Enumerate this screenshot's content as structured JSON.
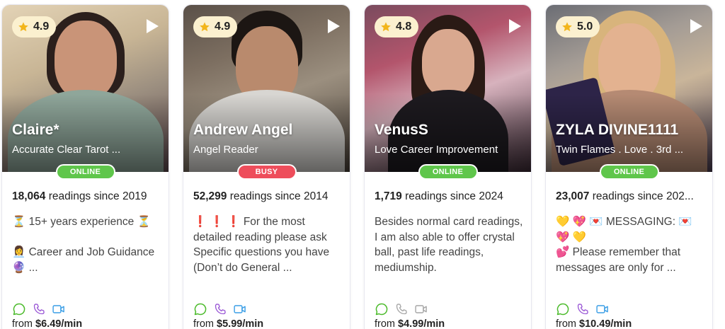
{
  "cards": [
    {
      "rating": "4.9",
      "name": "Claire*",
      "tagline": "Accurate Clear Tarot ...",
      "status": "ONLINE",
      "readings_count": "18,064",
      "readings_suffix": " readings since 2019",
      "description": "⏳ 15+ years experience ⏳\n\n👩‍💼 Career and Job Guidance 🔮 ...",
      "price_prefix": "from ",
      "price": "$6.49/min",
      "contact_icons": [
        "chat-icon",
        "phone-icon",
        "video-icon"
      ],
      "icon_colors": [
        "#4cbb2c",
        "#9b59d6",
        "#3a9ee6"
      ]
    },
    {
      "rating": "4.9",
      "name": "Andrew Angel",
      "tagline": "Angel Reader",
      "status": "BUSY",
      "readings_count": "52,299",
      "readings_suffix": " readings since 2014",
      "description": "❗ ❗ ❗ For the most detailed reading please ask Specific questions you have (Don’t do General ...",
      "price_prefix": "from ",
      "price": "$5.99/min",
      "contact_icons": [
        "chat-icon",
        "phone-icon",
        "video-icon"
      ],
      "icon_colors": [
        "#4cbb2c",
        "#9b59d6",
        "#3a9ee6"
      ]
    },
    {
      "rating": "4.8",
      "name": "VenusS",
      "tagline": "Love Career Improvement",
      "status": "ONLINE",
      "readings_count": "1,719",
      "readings_suffix": " readings since 2024",
      "description": "Besides normal card readings, I am also able to offer crystal ball, past life readings, mediumship.",
      "price_prefix": "from ",
      "price": "$4.99/min",
      "contact_icons": [
        "chat-icon",
        "phone-icon",
        "video-icon"
      ],
      "icon_colors": [
        "#4cbb2c",
        "#a6a6a6",
        "#a6a6a6"
      ]
    },
    {
      "rating": "5.0",
      "name": "ZYLA DIVINE1111",
      "tagline": "Twin Flames . Love . 3rd ...",
      "status": "ONLINE",
      "readings_count": "23,007",
      "readings_suffix": " readings since 202...",
      "description": "💛 💖 💌 MESSAGING: 💌 💖 💛\n💕 Please remember that messages are only for ...",
      "price_prefix": "from ",
      "price": "$10.49/min",
      "contact_icons": [
        "chat-icon",
        "phone-icon",
        "video-icon"
      ],
      "icon_colors": [
        "#4cbb2c",
        "#9b59d6",
        "#3a9ee6"
      ]
    }
  ],
  "colors": {
    "online": "#5fc64b",
    "busy": "#ee4d5b",
    "rating_bg": "#fbf0cf",
    "star": "#f2b51b"
  }
}
